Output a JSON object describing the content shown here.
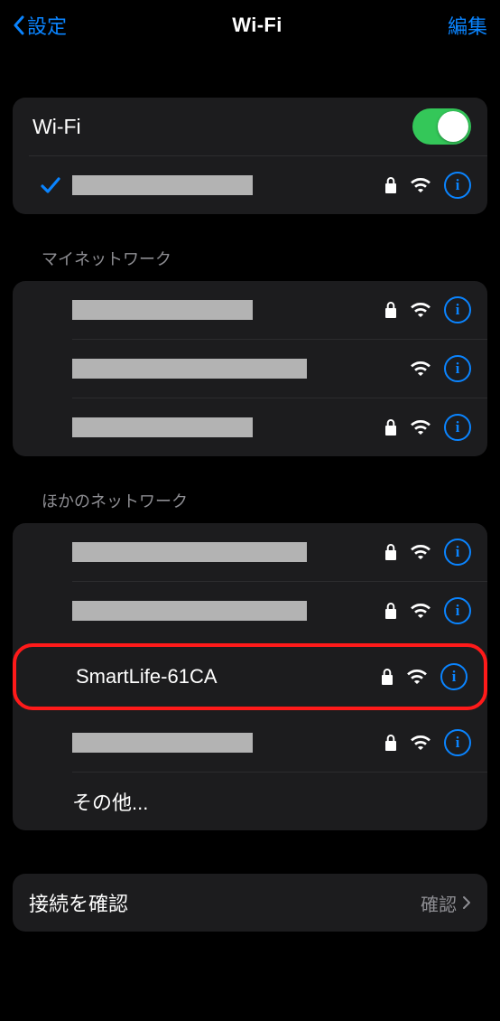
{
  "nav": {
    "back": "設定",
    "title": "Wi-Fi",
    "action": "編集"
  },
  "wifi": {
    "label": "Wi-Fi",
    "enabled": true
  },
  "connected": {
    "name_redacted": true,
    "locked": true,
    "signal": "strong"
  },
  "sections": {
    "my": {
      "title": "マイネットワーク",
      "items": [
        {
          "name_redacted": true,
          "locked": true,
          "signal": "weak"
        },
        {
          "name_redacted": true,
          "locked": false,
          "signal": "strong"
        },
        {
          "name_redacted": true,
          "locked": true,
          "signal": "strong"
        }
      ]
    },
    "other": {
      "title": "ほかのネットワーク",
      "items": [
        {
          "name_redacted": true,
          "locked": true,
          "signal": "weak"
        },
        {
          "name_redacted": true,
          "locked": true,
          "signal": "strong"
        },
        {
          "name": "SmartLife-61CA",
          "locked": true,
          "signal": "weak",
          "highlighted": true
        },
        {
          "name_redacted": true,
          "locked": true,
          "signal": "strong"
        }
      ],
      "more": "その他..."
    }
  },
  "footer": {
    "ask": {
      "label": "接続を確認",
      "value": "確認"
    }
  }
}
